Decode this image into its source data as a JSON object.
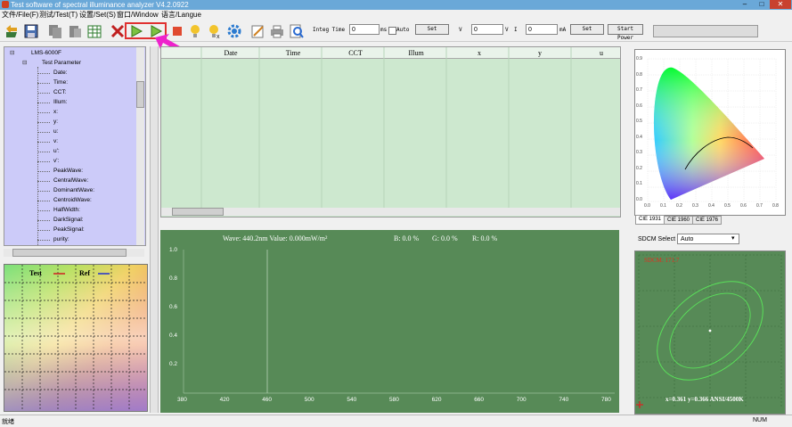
{
  "window": {
    "title": "Test software of spectral illuminance analyzer V4.2.0922"
  },
  "menu": [
    "文件/File(F)",
    "测试/Test(T)",
    "设置/Set(S)",
    "窗口/Window",
    "语言/Langue"
  ],
  "toolbar": {
    "integ_label": "Integ Time",
    "integ_value": "0",
    "integ_unit": "ms",
    "auto_label": "Auto",
    "set_label": "Set",
    "v_label": "V",
    "v_value": "0",
    "v_unit": "V",
    "i_label": "I",
    "i_value": "0",
    "i_unit": "mA",
    "set2_label": "Set",
    "start_power_label": "Start Power"
  },
  "tree": {
    "root": "LMS-6000F",
    "group": "Test Parameter",
    "items": [
      "Date:",
      "Time:",
      "CCT:",
      "Illum:",
      "x:",
      "y:",
      "u:",
      "v:",
      "u':",
      "v':",
      "PeakWave:",
      "CentralWave:",
      "DominantWave:",
      "CentroidWave:",
      "HalfWidth:",
      "DarkSignal:",
      "PeakSignal:",
      "purity:"
    ]
  },
  "table": {
    "columns": [
      "Date",
      "Time",
      "CCT",
      "Illum",
      "x",
      "y",
      "u"
    ]
  },
  "spectrum": {
    "wave_text": "Wave: 440.2nm Value: 0.000mW/m²",
    "b_text": "B: 0.0 %",
    "g_text": "G: 0.0 %",
    "r_text": "R: 0.0 %",
    "y_ticks": [
      "1.0",
      "0.8",
      "0.6",
      "0.4",
      "0.2"
    ],
    "x_ticks": [
      "380",
      "420",
      "460",
      "500",
      "540",
      "580",
      "620",
      "660",
      "700",
      "740",
      "780"
    ]
  },
  "color_square": {
    "test_label": "Test",
    "ref_label": "Ref"
  },
  "cie": {
    "tabs": [
      "CIE 1931",
      "CIE 1960",
      "CIE 1976"
    ],
    "x_ticks": [
      "0.0",
      "0.1",
      "0.2",
      "0.3",
      "0.4",
      "0.5",
      "0.6",
      "0.7",
      "0.8"
    ],
    "y_ticks": [
      "0.9",
      "0.8",
      "0.7",
      "0.6",
      "0.5",
      "0.4",
      "0.3",
      "0.2",
      "0.1",
      "0.0"
    ]
  },
  "sdcm": {
    "select_label": "SDCM Select",
    "select_value": "Auto",
    "title": "SDCM: 171.7",
    "readout": "x=0.361 y=0.366 ANSI/4500K"
  },
  "status": {
    "left": "就绪",
    "right": "NUM"
  },
  "colors": {
    "panel_green": "#578a57",
    "table_green": "#cde8cf",
    "tree_lilac": "#cccbf9",
    "highlight_red": "#e03030",
    "arrow_magenta": "#ee22cc"
  }
}
